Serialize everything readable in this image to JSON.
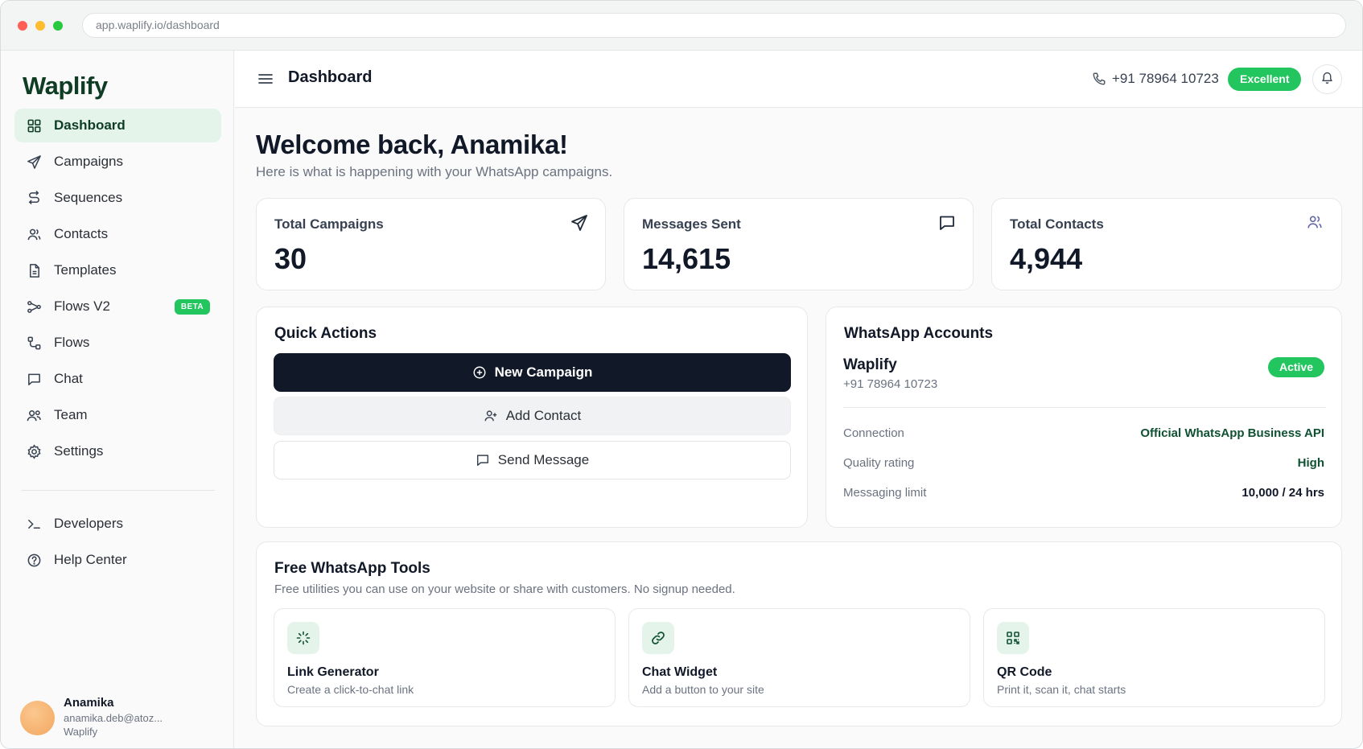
{
  "browser": {
    "url": "app.waplify.io/dashboard"
  },
  "sidebar": {
    "logo": "Waplify",
    "items": [
      {
        "label": "Dashboard",
        "icon": "grid-icon",
        "active": true
      },
      {
        "label": "Campaigns",
        "icon": "send-icon"
      },
      {
        "label": "Sequences",
        "icon": "sequence-icon"
      },
      {
        "label": "Contacts",
        "icon": "users-icon"
      },
      {
        "label": "Templates",
        "icon": "file-icon"
      },
      {
        "label": "Flows V2",
        "icon": "flow-icon",
        "badge": "BETA"
      },
      {
        "label": "Flows",
        "icon": "route-icon"
      },
      {
        "label": "Chat",
        "icon": "chat-icon"
      },
      {
        "label": "Team",
        "icon": "team-icon"
      },
      {
        "label": "Settings",
        "icon": "gear-icon"
      }
    ],
    "secondary": [
      {
        "label": "Developers",
        "icon": "terminal-icon"
      },
      {
        "label": "Help Center",
        "icon": "help-icon"
      }
    ],
    "user": {
      "name": "Anamika",
      "email": "anamika.deb@atoz...",
      "org": "Waplify"
    }
  },
  "header": {
    "title": "Dashboard",
    "phone": "+91 78964 10723",
    "quality": "Excellent"
  },
  "welcome": {
    "title": "Welcome back, Anamika!",
    "subtitle": "Here is what is happening with your WhatsApp campaigns."
  },
  "stats": [
    {
      "label": "Total Campaigns",
      "value": "30",
      "icon": "send-icon"
    },
    {
      "label": "Messages Sent",
      "value": "14,615",
      "icon": "chat-icon"
    },
    {
      "label": "Total Contacts",
      "value": "4,944",
      "icon": "users-icon"
    }
  ],
  "quick_actions": {
    "title": "Quick Actions",
    "new_campaign": "New Campaign",
    "add_contact": "Add Contact",
    "send_message": "Send Message"
  },
  "accounts": {
    "title": "WhatsApp Accounts",
    "name": "Waplify",
    "phone": "+91 78964 10723",
    "status": "Active",
    "rows": [
      {
        "label": "Connection",
        "value": "Official WhatsApp Business API"
      },
      {
        "label": "Quality rating",
        "value": "High"
      },
      {
        "label": "Messaging limit",
        "value": "10,000 / 24 hrs"
      }
    ]
  },
  "tools": {
    "title": "Free WhatsApp Tools",
    "subtitle": "Free utilities you can use on your website or share with customers. No signup needed.",
    "items": [
      {
        "title": "Link Generator",
        "desc": "Create a click-to-chat link",
        "icon": "sparkle-icon"
      },
      {
        "title": "Chat Widget",
        "desc": "Add a button to your site",
        "icon": "link-icon"
      },
      {
        "title": "QR Code",
        "desc": "Print it, scan it, chat starts",
        "icon": "qr-icon"
      }
    ]
  },
  "colors": {
    "brand": "#0f3d24",
    "accent": "#22c55e",
    "primary_button": "#111827"
  }
}
